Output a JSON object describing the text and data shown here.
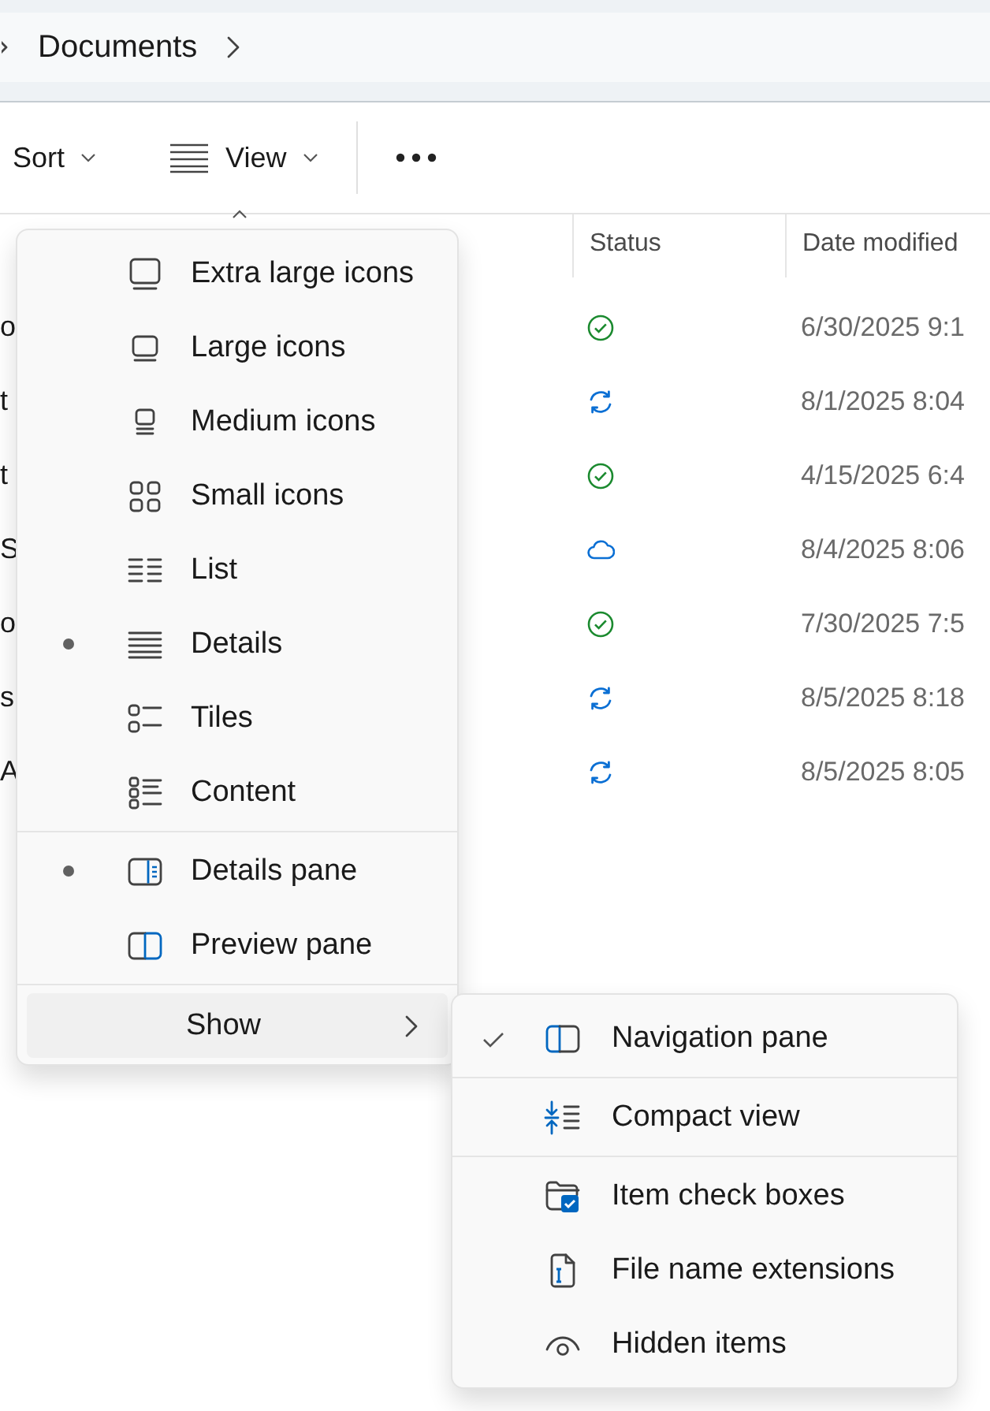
{
  "breadcrumb": {
    "items": [
      "Documents"
    ]
  },
  "toolbar": {
    "sort": "Sort",
    "view": "View"
  },
  "file_list": {
    "columns": [
      "Status",
      "Date modified"
    ],
    "rows": [
      {
        "name": "o",
        "kind": "synced",
        "date": "6/30/2025 9:1"
      },
      {
        "name": "t",
        "kind": "syncing",
        "date": "8/1/2025 8:04"
      },
      {
        "name": "t",
        "kind": "synced",
        "date": "4/15/2025 6:4"
      },
      {
        "name": "S",
        "kind": "cloud",
        "date": "8/4/2025 8:06"
      },
      {
        "name": "o",
        "kind": "synced",
        "date": "7/30/2025 7:5"
      },
      {
        "name": "s",
        "kind": "syncing",
        "date": "8/5/2025 8:18"
      },
      {
        "name": "A",
        "kind": "syncing",
        "date": "8/5/2025 8:05"
      }
    ]
  },
  "view_menu": {
    "layouts": [
      {
        "label": "Extra large icons",
        "selected": false
      },
      {
        "label": "Large icons",
        "selected": false
      },
      {
        "label": "Medium icons",
        "selected": false
      },
      {
        "label": "Small icons",
        "selected": false
      },
      {
        "label": "List",
        "selected": false
      },
      {
        "label": "Details",
        "selected": true
      },
      {
        "label": "Tiles",
        "selected": false
      },
      {
        "label": "Content",
        "selected": false
      }
    ],
    "panes": [
      {
        "label": "Details pane",
        "selected": true
      },
      {
        "label": "Preview pane",
        "selected": false
      }
    ],
    "show": {
      "label": "Show",
      "expanded": true,
      "groups": [
        [
          {
            "label": "Navigation pane",
            "checked": true
          }
        ],
        [
          {
            "label": "Compact view",
            "checked": false
          }
        ],
        [
          {
            "label": "Item check boxes",
            "checked": false
          },
          {
            "label": "File name extensions",
            "checked": false
          },
          {
            "label": "Hidden items",
            "checked": false
          }
        ]
      ]
    }
  }
}
